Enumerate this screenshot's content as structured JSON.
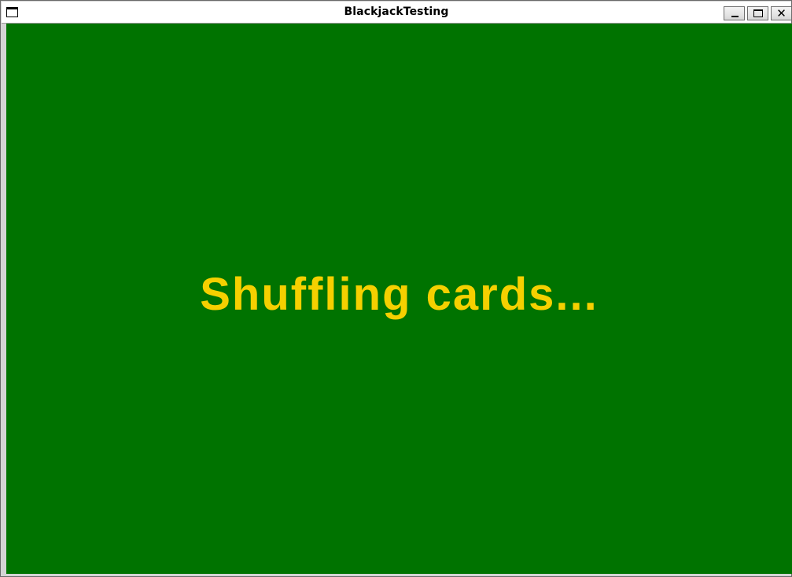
{
  "window": {
    "title": "BlackjackTesting",
    "buttons": {
      "minimize": "minimize-icon",
      "maximize": "maximize-icon",
      "close": "close-icon"
    },
    "close_glyph": "✕"
  },
  "table": {
    "background_color": "#007300",
    "status_message": "Shuffling cards...",
    "status_color": "#f5d000"
  }
}
